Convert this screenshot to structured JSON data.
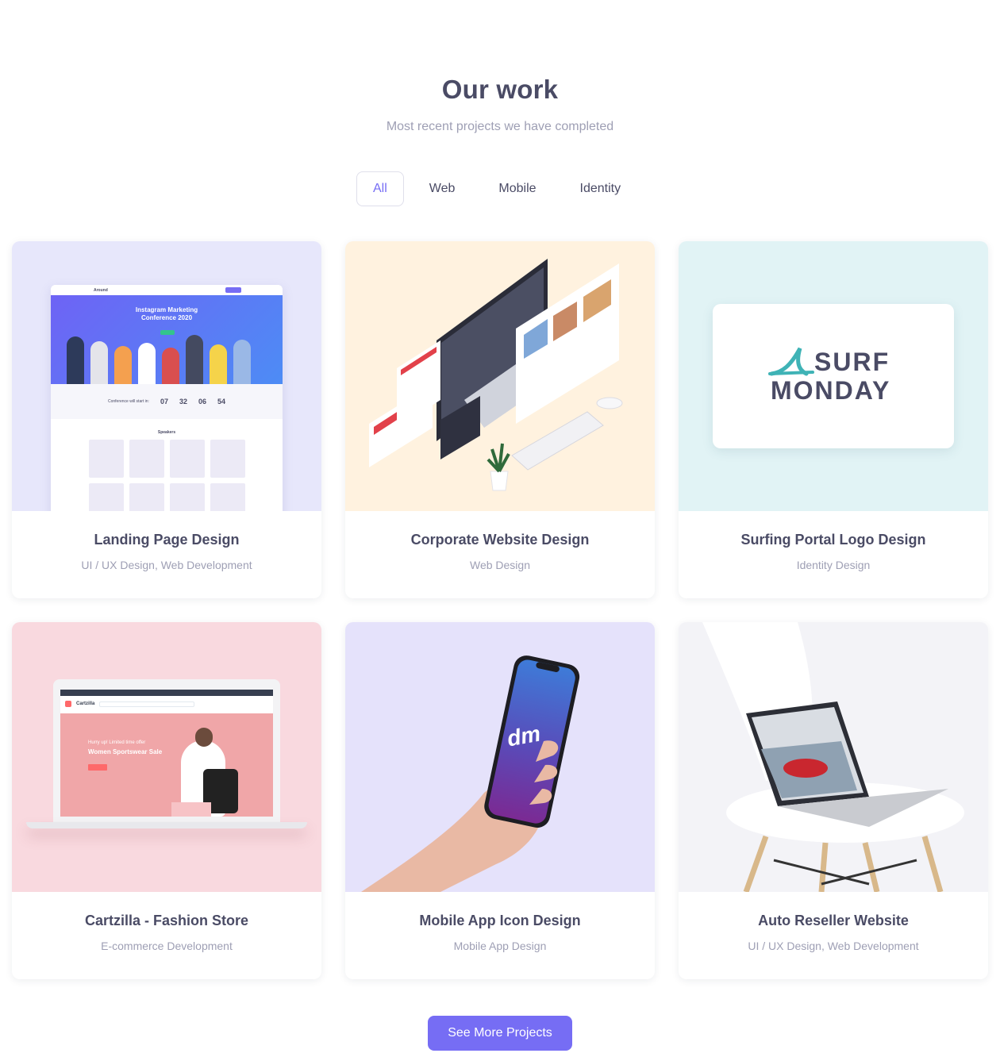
{
  "section": {
    "title": "Our work",
    "subtitle": "Most recent projects we have completed"
  },
  "filters": [
    {
      "label": "All",
      "active": true
    },
    {
      "label": "Web",
      "active": false
    },
    {
      "label": "Mobile",
      "active": false
    },
    {
      "label": "Identity",
      "active": false
    }
  ],
  "projects": [
    {
      "title": "Landing Page Design",
      "category": "UI / UX Design, Web Development",
      "bg": "#e7e7fb"
    },
    {
      "title": "Corporate Website Design",
      "category": "Web Design",
      "bg": "#fff2df"
    },
    {
      "title": "Surfing Portal Logo Design",
      "category": "Identity Design",
      "bg": "#e1f3f5"
    },
    {
      "title": "Cartzilla - Fashion Store",
      "category": "E-commerce Development",
      "bg": "#f9d9df"
    },
    {
      "title": "Mobile App Icon Design",
      "category": "Mobile App Design",
      "bg": "#e5e2fb"
    },
    {
      "title": "Auto Reseller Website",
      "category": "UI / UX Design, Web Development",
      "bg": "#f3f3f7"
    }
  ],
  "thumb_text": {
    "lp_brand": "Around",
    "lp_hero": "Instagram Marketing Conference 2020",
    "lp_countdown_label": "Conference will start in:",
    "lp_countdown": [
      "07",
      "32",
      "06",
      "54"
    ],
    "lp_speakers": "Speakers",
    "surf_line1": "SURF",
    "surf_line2": "MONDAY",
    "cz_brand": "Cartzilla",
    "cz_promo_small": "Hurry up! Limited time offer",
    "cz_promo_title": "Women Sportswear Sale",
    "app_icon": "dm"
  },
  "cta": {
    "label": "See More Projects"
  },
  "colors": {
    "accent": "#766df4",
    "heading": "#4a4b65",
    "muted": "#9e9fb4"
  }
}
